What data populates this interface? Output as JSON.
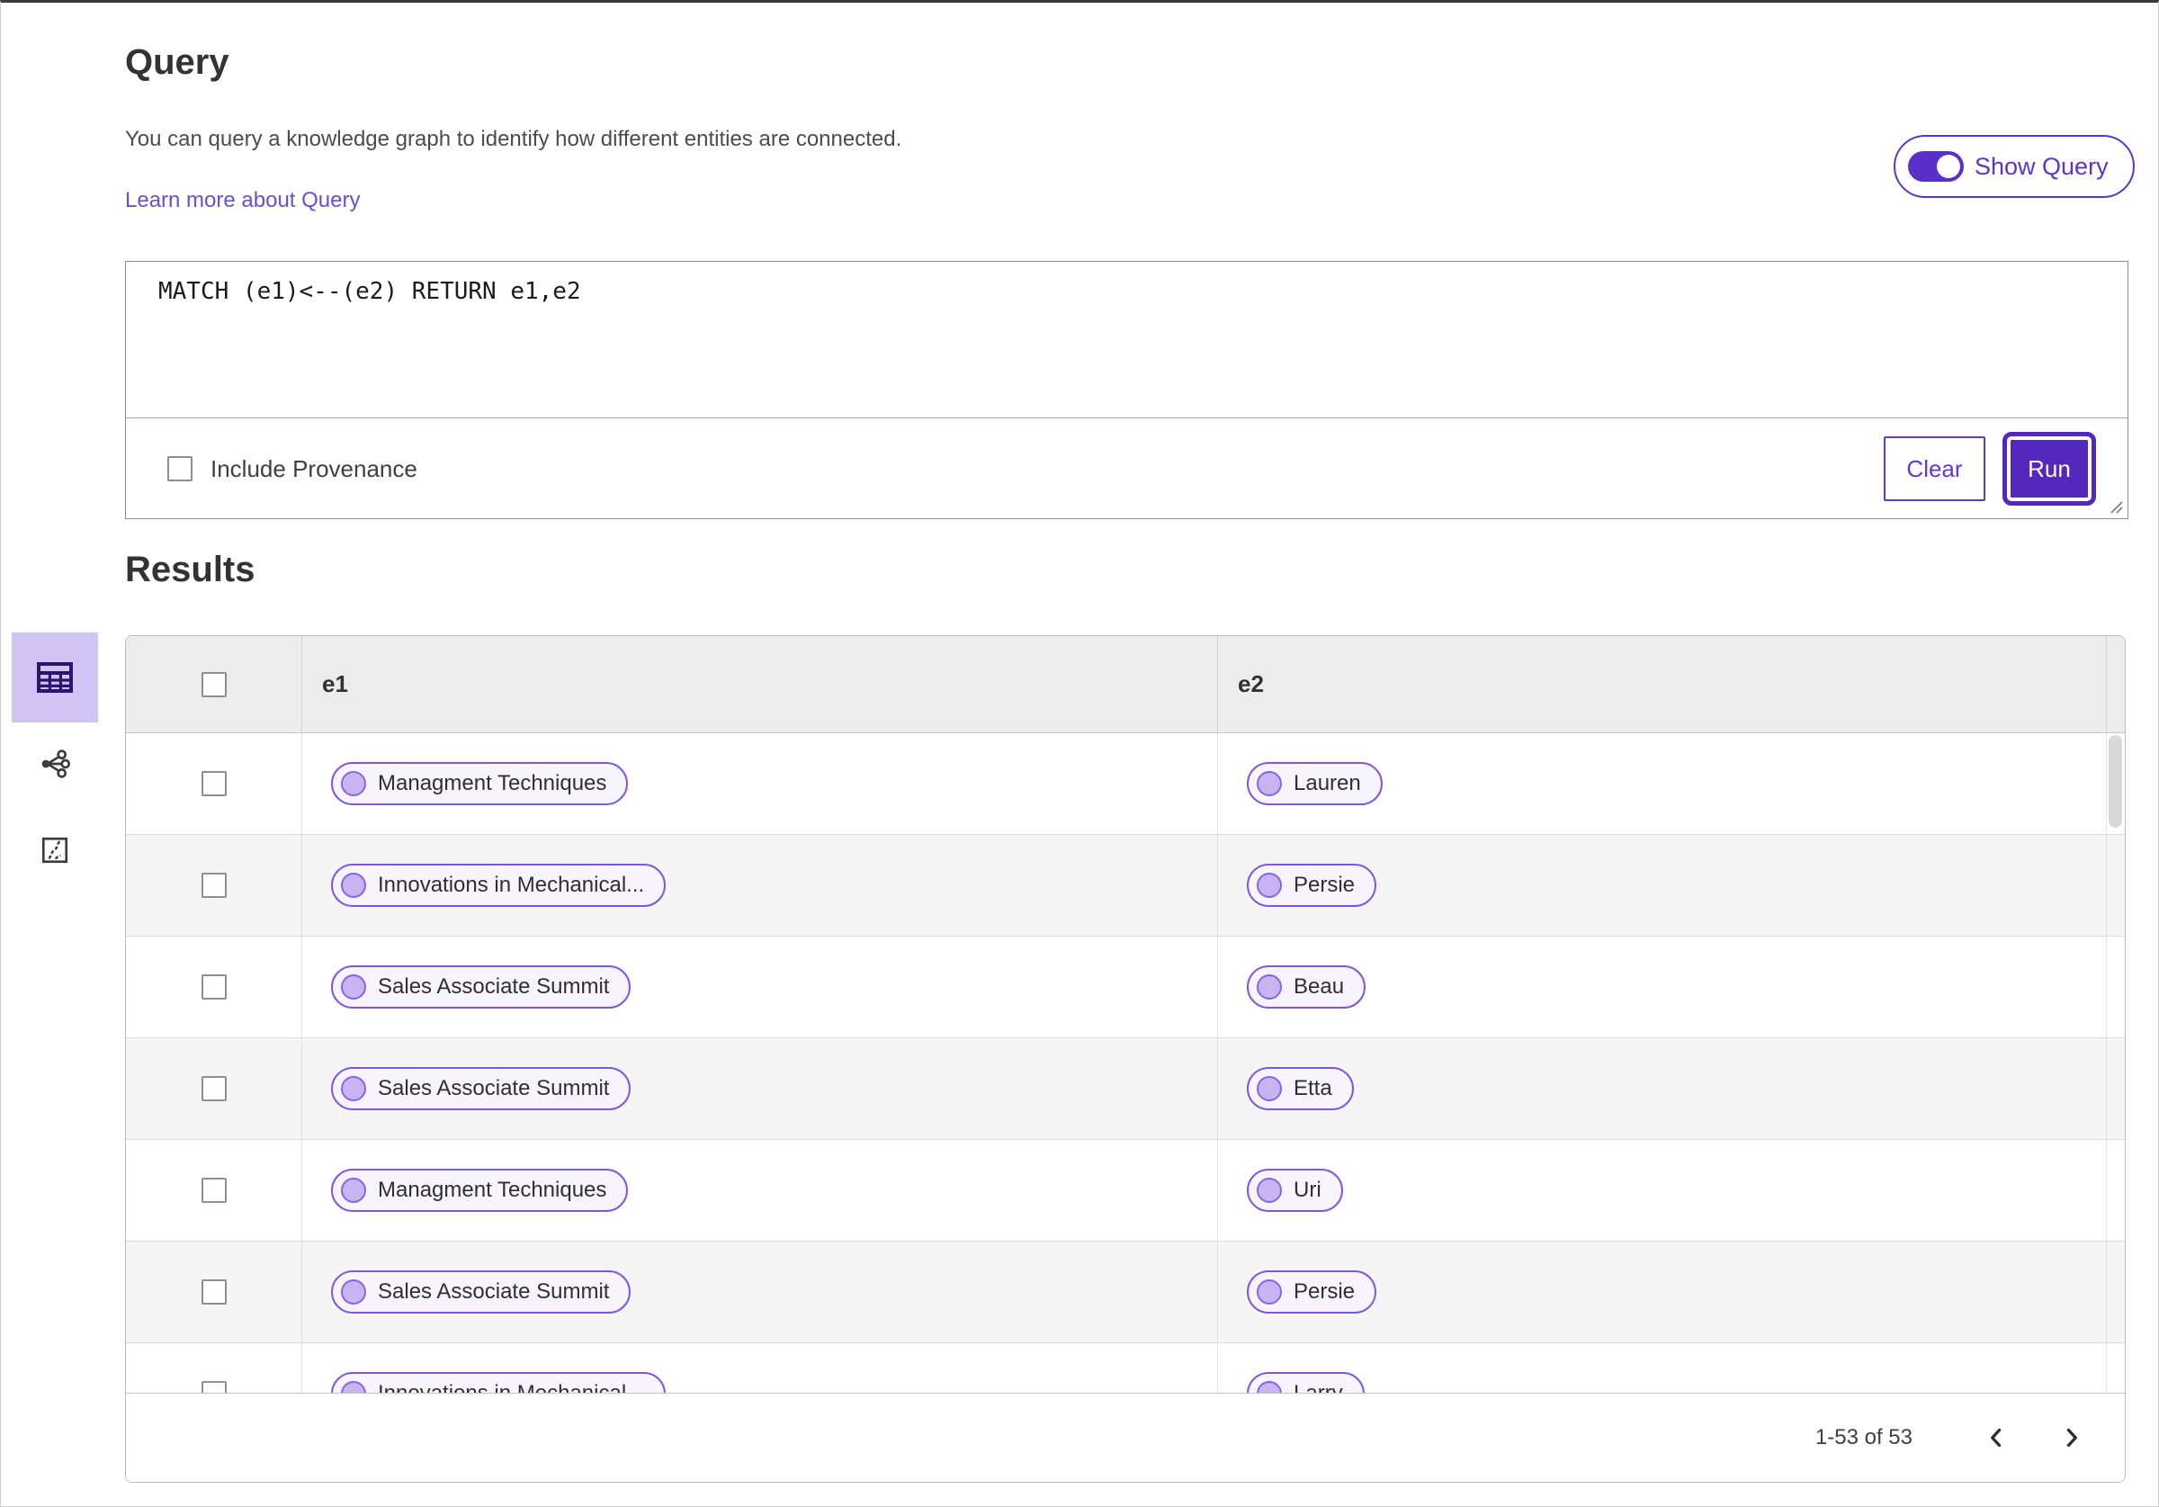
{
  "query": {
    "title": "Query",
    "description": "You can query a knowledge graph to identify how different entities are connected.",
    "learn_more": "Learn more about Query",
    "toggle_label": "Show Query",
    "toggle_state": "on",
    "text": "MATCH (e1)<--(e2) RETURN e1,e2",
    "include_provenance": "Include Provenance",
    "include_provenance_checked": false,
    "clear": "Clear",
    "run": "Run"
  },
  "results": {
    "title": "Results",
    "view_switcher": [
      {
        "icon": "table-view-icon",
        "selected": true
      },
      {
        "icon": "graph-view-icon",
        "selected": false
      },
      {
        "icon": "map-view-icon",
        "selected": false
      }
    ],
    "table": {
      "columns": [
        "e1",
        "e2"
      ],
      "rows": [
        {
          "e1": "Managment Techniques",
          "e2": "Lauren"
        },
        {
          "e1": "Innovations in Mechanical...",
          "e2": "Persie"
        },
        {
          "e1": "Sales Associate Summit",
          "e2": "Beau"
        },
        {
          "e1": "Sales Associate Summit",
          "e2": "Etta"
        },
        {
          "e1": "Managment Techniques",
          "e2": "Uri"
        },
        {
          "e1": "Sales Associate Summit",
          "e2": "Persie"
        },
        {
          "e1": "Innovations in Mechanical...",
          "e2": "Larry"
        }
      ],
      "pagination": {
        "label": "1-53 of 53",
        "prev_icon": "chevron-left-icon",
        "next_icon": "chevron-right-icon"
      }
    }
  },
  "colors": {
    "primary_purple": "#5428bd",
    "purple_border": "#6437cf",
    "link_purple": "#6a4fd0",
    "pill_border": "#7d57e4",
    "pill_bg": "#f7f4fe",
    "pill_circle": "#c8b4f1",
    "rail_selected_bg": "#d2c3f5",
    "header_bg": "#ececec",
    "row_alt_bg": "#f5f5f5"
  }
}
